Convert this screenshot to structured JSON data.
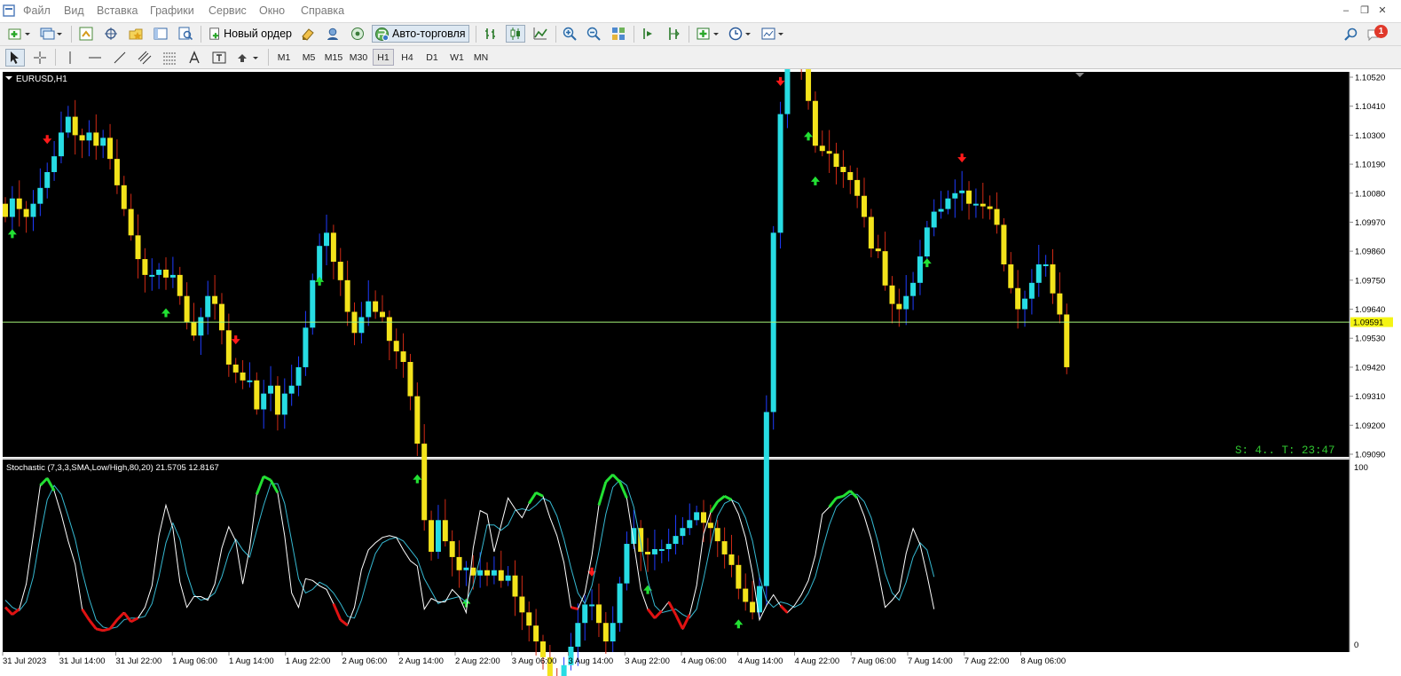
{
  "menu": {
    "items": [
      "Файл",
      "Вид",
      "Вставка",
      "Графики",
      "Сервис",
      "Окно",
      "Справка"
    ]
  },
  "toolbar": {
    "new_order_label": "Новый ордер",
    "autotrading_label": "Авто-торговля",
    "notifications_badge": "1"
  },
  "timeframes": [
    "M1",
    "M5",
    "M15",
    "M30",
    "H1",
    "H4",
    "D1",
    "W1",
    "MN"
  ],
  "active_timeframe": "H1",
  "chart": {
    "symbol_label": "EURUSD,H1",
    "price_axis_labels": [
      "1.10520",
      "1.10410",
      "1.10300",
      "1.10190",
      "1.10080",
      "1.09970",
      "1.09860",
      "1.09750",
      "1.09640",
      "1.09530",
      "1.09420",
      "1.09310",
      "1.09200",
      "1.09090"
    ],
    "current_price": "1.09591",
    "status_text": "S: 4.. T: 23:47",
    "time_axis_labels": [
      "31 Jul 2023",
      "31 Jul 14:00",
      "31 Jul 22:00",
      "1 Aug 06:00",
      "1 Aug 14:00",
      "1 Aug 22:00",
      "2 Aug 06:00",
      "2 Aug 14:00",
      "2 Aug 22:00",
      "3 Aug 06:00",
      "3 Aug 14:00",
      "3 Aug 22:00",
      "4 Aug 06:00",
      "4 Aug 14:00",
      "4 Aug 22:00",
      "7 Aug 06:00",
      "7 Aug 14:00",
      "7 Aug 22:00",
      "8 Aug 06:00"
    ],
    "candle_closes": [
      1.0999,
      1.1006,
      1.1002,
      1.0999,
      1.1004,
      1.101,
      1.1016,
      1.1022,
      1.1031,
      1.1037,
      1.103,
      1.1028,
      1.1031,
      1.1026,
      1.1029,
      1.1021,
      1.1011,
      1.1002,
      1.0992,
      1.0983,
      1.0977,
      1.0977,
      1.0979,
      1.0976,
      1.0977,
      1.0969,
      1.0959,
      1.0954,
      1.0961,
      1.0969,
      1.0966,
      1.0956,
      1.0943,
      1.094,
      1.0937,
      1.0937,
      1.0926,
      1.0932,
      1.0935,
      1.0924,
      1.0932,
      1.0935,
      1.0942,
      1.0957,
      1.0975,
      1.0988,
      1.0993,
      1.0982,
      1.0975,
      1.0963,
      1.0955,
      1.0961,
      1.0967,
      1.0963,
      1.0961,
      1.0952,
      1.0948,
      1.0944,
      1.0931,
      1.0913,
      1.0884,
      1.0872,
      1.0884,
      1.0876,
      1.087,
      1.0865,
      1.0866,
      1.0863,
      1.0865,
      1.0863,
      1.0865,
      1.0861,
      1.0863,
      1.0855,
      1.0849,
      1.0844,
      1.0838,
      1.0832,
      1.0821,
      1.0816,
      1.0829,
      1.0836,
      1.0845,
      1.0852,
      1.0852,
      1.0845,
      1.0838,
      1.0845,
      1.086,
      1.0875,
      1.0881,
      1.0872,
      1.0871,
      1.0873,
      1.0873,
      1.0875,
      1.0878,
      1.0881,
      1.0884,
      1.0887,
      1.0883,
      1.0881,
      1.0876,
      1.0871,
      1.0867,
      1.0858,
      1.0853,
      1.0849,
      1.0859,
      1.0925,
      1.0993,
      1.1038,
      1.1062,
      1.1066,
      1.1055,
      1.1043,
      1.1026,
      1.1024,
      1.1023,
      1.1018,
      1.1016,
      1.1013,
      1.1007,
      1.0999,
      1.0987,
      1.0986,
      1.0973,
      1.0966,
      1.0964,
      1.0969,
      1.0974,
      1.0984,
      1.0995,
      1.1001,
      1.1002,
      1.1006,
      1.1008,
      1.1009,
      1.1004,
      1.1004,
      1.1003,
      1.1002,
      1.0996,
      1.0981,
      1.0972,
      1.0964,
      1.0968,
      1.0974,
      1.0981,
      1.0981,
      1.097,
      1.0962,
      1.0942
    ],
    "sell_arrow_indices": [
      6,
      33,
      84,
      111,
      137
    ],
    "buy_arrow_indices": [
      1,
      23,
      45,
      59,
      66,
      92,
      105,
      115,
      116,
      132
    ]
  },
  "stochastic": {
    "label": "Stochastic (7,3,3,SMA,Low/High,80,20) 21.5705 12.8167",
    "scale_labels": [
      "100",
      "0"
    ],
    "main_values": [
      21,
      17,
      20,
      34,
      61,
      89,
      93,
      86,
      73,
      58,
      45,
      20,
      14,
      9,
      8,
      9,
      14,
      18,
      13,
      15,
      21,
      33,
      61,
      78,
      65,
      35,
      21,
      27,
      27,
      25,
      34,
      54,
      66,
      58,
      34,
      54,
      84,
      94,
      92,
      85,
      61,
      29,
      21,
      37,
      36,
      33,
      31,
      23,
      14,
      11,
      21,
      42,
      53,
      57,
      60,
      61,
      60,
      53,
      47,
      44,
      20,
      26,
      24,
      24,
      31,
      27,
      18,
      54,
      75,
      73,
      52,
      67,
      82,
      76,
      71,
      79,
      85,
      83,
      71,
      61,
      46,
      21,
      20,
      29,
      50,
      78,
      91,
      95,
      91,
      82,
      57,
      31,
      20,
      15,
      19,
      24,
      17,
      9,
      17,
      33,
      62,
      74,
      80,
      83,
      81,
      73,
      60,
      40,
      14,
      22,
      28,
      22,
      18,
      22,
      28,
      36,
      50,
      73,
      77,
      82,
      83,
      86,
      82,
      72,
      59,
      41,
      21,
      25,
      30,
      51,
      65,
      56,
      39,
      20
    ],
    "signal_values": [
      25,
      21,
      19,
      24,
      38,
      61,
      81,
      89,
      84,
      72,
      59,
      41,
      26,
      14,
      10,
      9,
      10,
      14,
      15,
      15,
      16,
      23,
      38,
      57,
      68,
      59,
      40,
      28,
      25,
      26,
      29,
      38,
      51,
      59,
      53,
      49,
      64,
      78,
      90,
      90,
      79,
      58,
      37,
      29,
      31,
      35,
      33,
      29,
      23,
      16,
      15,
      25,
      39,
      51,
      57,
      59,
      60,
      58,
      53,
      48,
      37,
      30,
      23,
      25,
      26,
      27,
      24,
      33,
      49,
      67,
      67,
      64,
      67,
      75,
      76,
      75,
      78,
      82,
      80,
      72,
      59,
      43,
      29,
      23,
      33,
      52,
      73,
      88,
      92,
      89,
      77,
      57,
      36,
      22,
      18,
      19,
      20,
      17,
      15,
      20,
      37,
      56,
      72,
      79,
      81,
      79,
      71,
      58,
      38,
      25,
      21,
      24,
      23,
      21,
      23,
      29,
      38,
      53,
      67,
      77,
      81,
      84,
      84,
      80,
      71,
      57,
      40,
      29,
      25,
      35,
      49,
      57,
      53,
      38
    ]
  },
  "colors": {
    "bull": "#27dce3",
    "bear": "#f3e31b",
    "wick_bull": "#1e3cff",
    "wick_bear": "#d02a14",
    "price_line": "#a6f77a",
    "arrow_up": "#22e033",
    "arrow_down": "#ff1a1a",
    "stoch_main": "#ffffff",
    "stoch_signal": "#36b9d2",
    "stoch_over": "#22e033",
    "stoch_under": "#e01212"
  }
}
